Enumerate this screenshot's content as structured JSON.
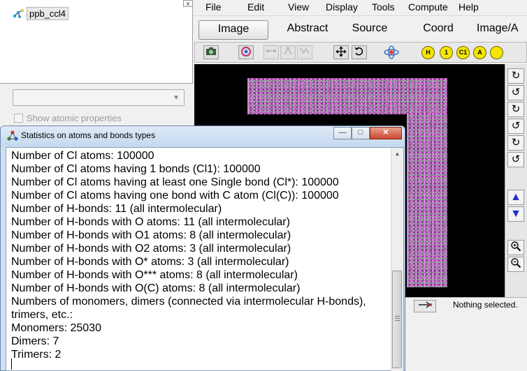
{
  "tree": {
    "root_label": "ppb_ccl4",
    "close_glyph": "x"
  },
  "left_panel": {
    "dropdown_value": "",
    "show_atomic_properties": "Show atomic properties"
  },
  "menu": [
    "File",
    "Edit",
    "View",
    "Display",
    "Tools",
    "Compute",
    "Help"
  ],
  "tabs": {
    "active": "Image",
    "items": [
      "Image",
      "Abstract",
      "Source",
      "Coord",
      "Image/A"
    ]
  },
  "toolbar": {
    "atom_label_buttons": [
      "H",
      "1",
      "C1",
      "A",
      ""
    ]
  },
  "status": {
    "text": "Nothing selected."
  },
  "dialog": {
    "title": "Statistics on atoms and bonds types",
    "lines": [
      "Number of Cl atoms: 100000",
      "Number of Cl atoms having 1 bonds (Cl1): 100000",
      "Number of Cl atoms having at least one Single bond (Cl*): 100000",
      "Number of Cl atoms having one bond with C atom (Cl(C)): 100000",
      "Number of H-bonds: 11 (all intermolecular)",
      "Number of H-bonds with O atoms: 11 (all intermolecular)",
      "Number of H-bonds with O1 atoms: 8 (all intermolecular)",
      "Number of H-bonds with O2 atoms: 3 (all intermolecular)",
      "Number of H-bonds with O* atoms: 3 (all intermolecular)",
      "Number of H-bonds with O*** atoms: 8 (all intermolecular)",
      "Number of H-bonds with O(C) atoms: 8 (all intermolecular)",
      "Numbers of monomers, dimers (connected via intermolecular H-bonds), trimers, etc.:",
      "Monomers: 25030",
      "Dimers: 7",
      "Trimers: 2"
    ]
  },
  "colors": {
    "viewer_bg": "#000000",
    "atom_magenta": "#ff80ff",
    "atom_button_yellow": "#f4e600",
    "arrow_blue": "#2030d0",
    "dialog_frame": "#cfe1f3"
  }
}
